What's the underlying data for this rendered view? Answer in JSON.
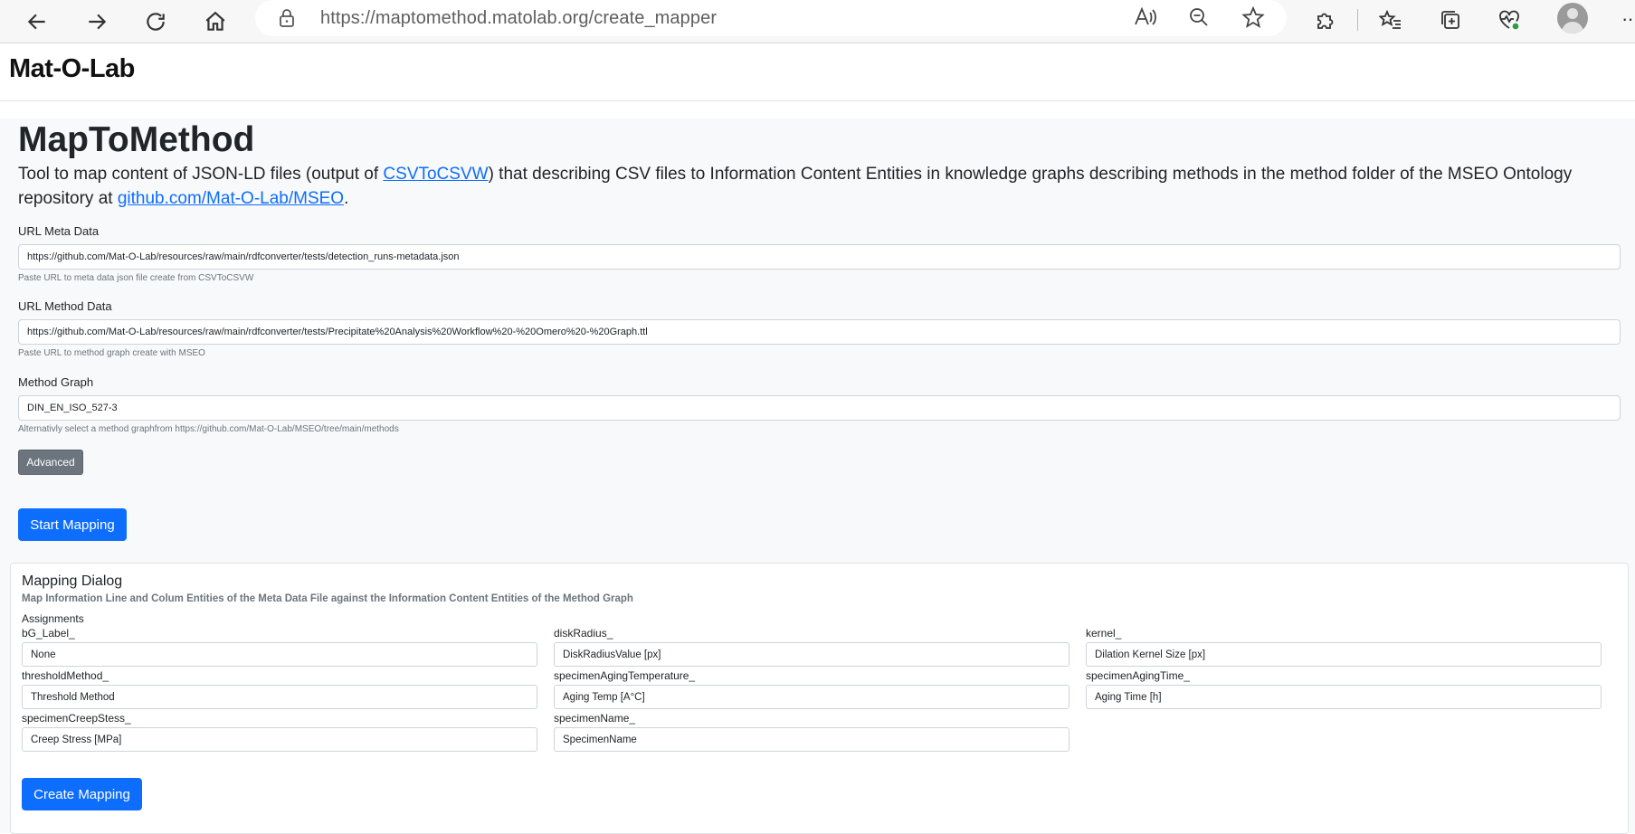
{
  "browser": {
    "url_host": "https://maptomethod.matolab.org",
    "url_path": "/create_mapper",
    "more_label": "···"
  },
  "site": {
    "brand": "Mat-O-Lab"
  },
  "page": {
    "title": "MapToMethod",
    "lead_before": "Tool to map content of JSON-LD files (output of ",
    "lead_link1": "CSVToCSVW",
    "lead_middle": ") that describing CSV files to Information Content Entities in knowledge graphs describing methods in the method folder of the MSEO Ontology repository at ",
    "lead_link2": "github.com/Mat-O-Lab/MSEO",
    "lead_after": "."
  },
  "form": {
    "meta_label": "URL Meta Data",
    "meta_value": "https://github.com/Mat-O-Lab/resources/raw/main/rdfconverter/tests/detection_runs-metadata.json",
    "meta_help": "Paste URL to meta data json file create from CSVToCSVW",
    "method_label": "URL Method Data",
    "method_value": "https://github.com/Mat-O-Lab/resources/raw/main/rdfconverter/tests/Precipitate%20Analysis%20Workflow%20-%20Omero%20-%20Graph.ttl",
    "method_help": "Paste URL to method graph create with MSEO",
    "graph_label": "Method Graph",
    "graph_value": "DIN_EN_ISO_527-3",
    "graph_help": "Alternativly select a method graphfrom https://github.com/Mat-O-Lab/MSEO/tree/main/methods",
    "advanced_label": "Advanced",
    "start_label": "Start Mapping"
  },
  "mapping": {
    "title": "Mapping Dialog",
    "subtitle": "Map Information Line and Colum Entities of the Meta Data File against the Information Content Entities of the Method Graph",
    "assignments_label": "Assignments",
    "fields": [
      {
        "label": "bG_Label_",
        "value": "None"
      },
      {
        "label": "diskRadius_",
        "value": "DiskRadiusValue [px]"
      },
      {
        "label": "kernel_",
        "value": "Dilation Kernel Size [px]"
      },
      {
        "label": "thresholdMethod_",
        "value": "Threshold Method"
      },
      {
        "label": "specimenAgingTemperature_",
        "value": "Aging Temp [Â°C]"
      },
      {
        "label": "specimenAgingTime_",
        "value": "Aging Time [h]"
      },
      {
        "label": "specimenCreepStess_",
        "value": "Creep Stress [MPa]"
      },
      {
        "label": "specimenName_",
        "value": "SpecimenName"
      }
    ],
    "create_label": "Create Mapping"
  }
}
